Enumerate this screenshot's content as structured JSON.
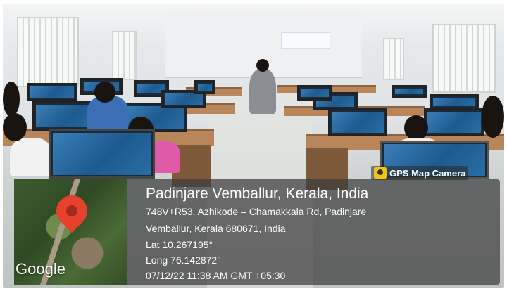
{
  "camera_badge": {
    "label": "GPS Map Camera"
  },
  "location": {
    "title": "Padinjare Vemballur, Kerala, India",
    "address_line1": "748V+R53, Azhikode – Chamakkala Rd, Padinjare",
    "address_line2": "Vemballur, Kerala 680671, India",
    "lat": "Lat 10.267195°",
    "long": "Long 76.142872°",
    "timestamp": "07/12/22 11:38 AM GMT +05:30"
  },
  "map": {
    "provider_label": "Google"
  }
}
